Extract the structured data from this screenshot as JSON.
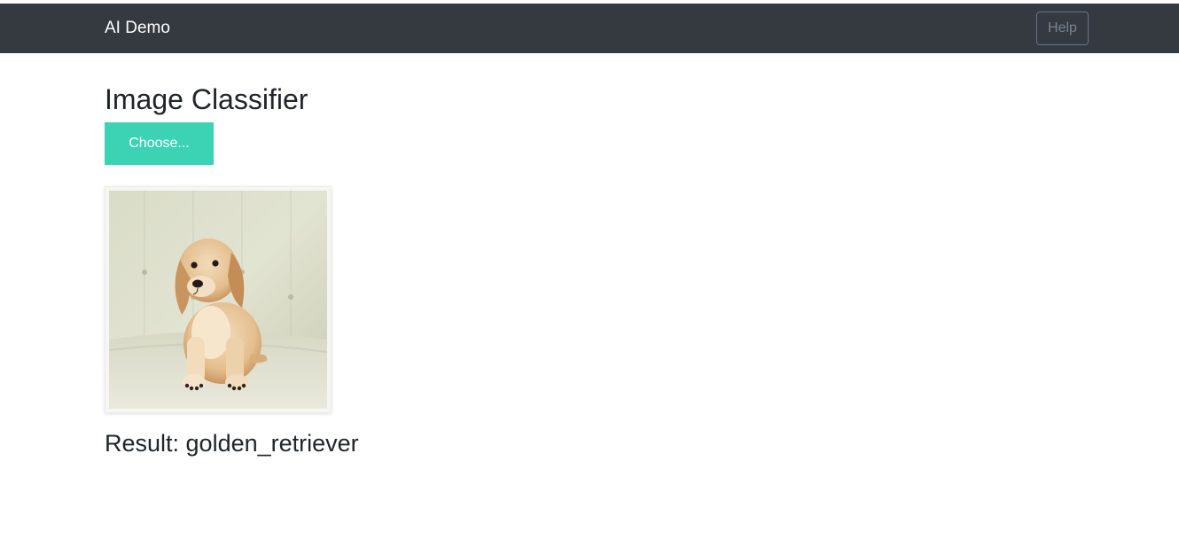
{
  "navbar": {
    "brand": "AI Demo",
    "help_label": "Help"
  },
  "main": {
    "title": "Image Classifier",
    "choose_label": "Choose...",
    "result_text": "Result: golden_retriever"
  },
  "colors": {
    "navbar_bg": "#343a40",
    "choose_button_bg": "#3bd3b3",
    "text": "#212529"
  }
}
